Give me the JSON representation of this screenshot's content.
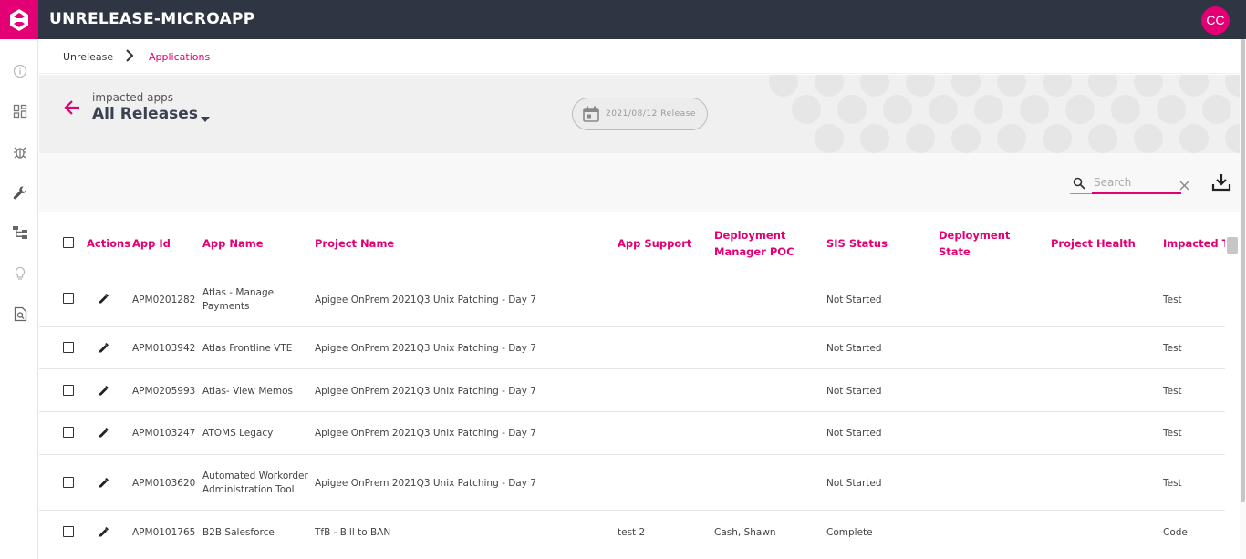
{
  "app": {
    "title": "UNRELEASE-MICROAPP",
    "avatar_initials": "CC",
    "accent": "#e20074"
  },
  "sidebar": {
    "items": [
      {
        "icon": "info-icon"
      },
      {
        "icon": "dashboard-icon"
      },
      {
        "icon": "bug-icon"
      },
      {
        "icon": "wrench-icon"
      },
      {
        "icon": "hierarchy-icon"
      },
      {
        "icon": "lightbulb-icon"
      },
      {
        "icon": "document-search-icon"
      }
    ]
  },
  "breadcrumb": {
    "root": "Unrelease",
    "current": "Applications"
  },
  "header": {
    "sub_label": "impacted apps",
    "release_title": "All Releases",
    "release_chip": "2021/08/12 Release"
  },
  "toolbar": {
    "search_placeholder": "Search"
  },
  "table": {
    "columns": {
      "actions": "Actions",
      "app_id": "App Id",
      "app_name": "App Name",
      "project_name": "Project Name",
      "app_support": "App Support",
      "deployment_manager_poc": "Deployment Manager POC",
      "sis_status": "SIS Status",
      "deployment_state": "Deployment State",
      "project_health": "Project Health",
      "impacted_type": "Impacted Ty"
    },
    "rows": [
      {
        "app_id": "APM0201282",
        "app_name": "Atlas - Manage Payments",
        "project_name": "Apigee OnPrem 2021Q3 Unix Patching - Day 7",
        "app_support": "",
        "deployment_manager_poc": "",
        "sis_status": "Not Started",
        "deployment_state": "",
        "project_health": "",
        "impacted_type": "Test"
      },
      {
        "app_id": "APM0103942",
        "app_name": "Atlas Frontline VTE",
        "project_name": "Apigee OnPrem 2021Q3 Unix Patching - Day 7",
        "app_support": "",
        "deployment_manager_poc": "",
        "sis_status": "Not Started",
        "deployment_state": "",
        "project_health": "",
        "impacted_type": "Test"
      },
      {
        "app_id": "APM0205993",
        "app_name": "Atlas- View Memos",
        "project_name": "Apigee OnPrem 2021Q3 Unix Patching - Day 7",
        "app_support": "",
        "deployment_manager_poc": "",
        "sis_status": "Not Started",
        "deployment_state": "",
        "project_health": "",
        "impacted_type": "Test"
      },
      {
        "app_id": "APM0103247",
        "app_name": "ATOMS Legacy",
        "project_name": "Apigee OnPrem 2021Q3 Unix Patching - Day 7",
        "app_support": "",
        "deployment_manager_poc": "",
        "sis_status": "Not Started",
        "deployment_state": "",
        "project_health": "",
        "impacted_type": "Test"
      },
      {
        "app_id": "APM0103620",
        "app_name": "Automated Workorder Administration Tool",
        "project_name": "Apigee OnPrem 2021Q3 Unix Patching - Day 7",
        "app_support": "",
        "deployment_manager_poc": "",
        "sis_status": "Not Started",
        "deployment_state": "",
        "project_health": "",
        "impacted_type": "Test"
      },
      {
        "app_id": "APM0101765",
        "app_name": "B2B Salesforce",
        "project_name": "TfB - Bill to BAN",
        "app_support": "test 2",
        "deployment_manager_poc": "Cash, Shawn",
        "sis_status": "Complete",
        "deployment_state": "",
        "project_health": "",
        "impacted_type": "Code"
      }
    ]
  }
}
